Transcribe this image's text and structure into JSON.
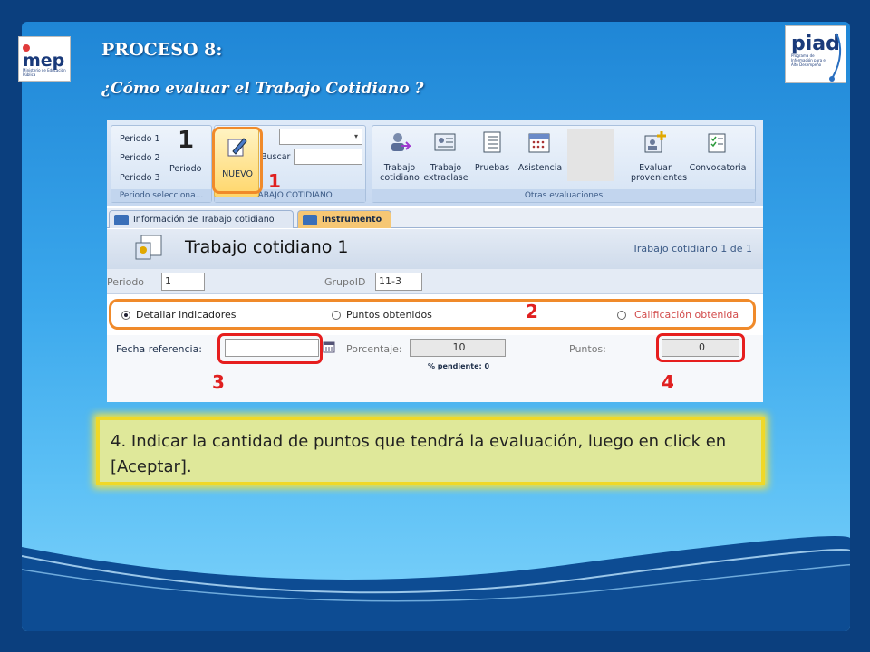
{
  "slide": {
    "title": "PROCESO 8:",
    "subtitle": "¿Cómo evaluar el Trabajo Cotidiano ?",
    "logo_left": "mep",
    "logo_left_caption": "Ministerio de Educación Pública",
    "logo_right": "piad",
    "logo_right_caption": "Programa de Información para el Alto Desempeño"
  },
  "ribbon": {
    "periods": [
      "Periodo 1",
      "Periodo 2",
      "Periodo 3"
    ],
    "periodo_label": "Periodo",
    "periodo_group_label": "Periodo selecciona...",
    "big_number": "1",
    "nuevo_label": "NUEVO",
    "buscar_label": "Buscar",
    "trabajo_group_label": "TRABAJO COTIDIANO",
    "otras": [
      {
        "label": "Trabajo cotidiano"
      },
      {
        "label": "Trabajo extraclase"
      },
      {
        "label": "Pruebas"
      },
      {
        "label": "Asistencia"
      },
      {
        "label": "Evaluar provenientes"
      },
      {
        "label": "Convocatoria"
      }
    ],
    "otras_group_label": "Otras evaluaciones"
  },
  "tabs": [
    {
      "label": "Información de Trabajo cotidiano"
    },
    {
      "label": "Instrumento"
    }
  ],
  "form": {
    "title": "Trabajo cotidiano 1",
    "record_count": "Trabajo cotidiano 1 de 1",
    "periodo_label": "Periodo",
    "periodo_value": "1",
    "grupo_label": "GrupoID",
    "grupo_value": "11-3",
    "options": [
      {
        "label": "Detallar indicadores",
        "selected": true
      },
      {
        "label": "Puntos obtenidos",
        "selected": false
      },
      {
        "label": "Calificación obtenida",
        "selected": false
      }
    ],
    "fecha_label": "Fecha referencia:",
    "fecha_value": "",
    "porcentaje_label": "Porcentaje:",
    "porcentaje_value": "10",
    "pendiente_label": "% pendiente: 0",
    "puntos_label": "Puntos:",
    "puntos_value": "0"
  },
  "callouts": {
    "n1": "1",
    "n2": "2",
    "n3": "3",
    "n4": "4"
  },
  "note": "4. Indicar la cantidad de puntos que tendrá la evaluación, luego en click en [Aceptar].",
  "colors": {
    "orange": "#f08a2a",
    "red": "#e61e1e",
    "note_bg": "#dfe89a",
    "note_border": "#f0d828"
  }
}
